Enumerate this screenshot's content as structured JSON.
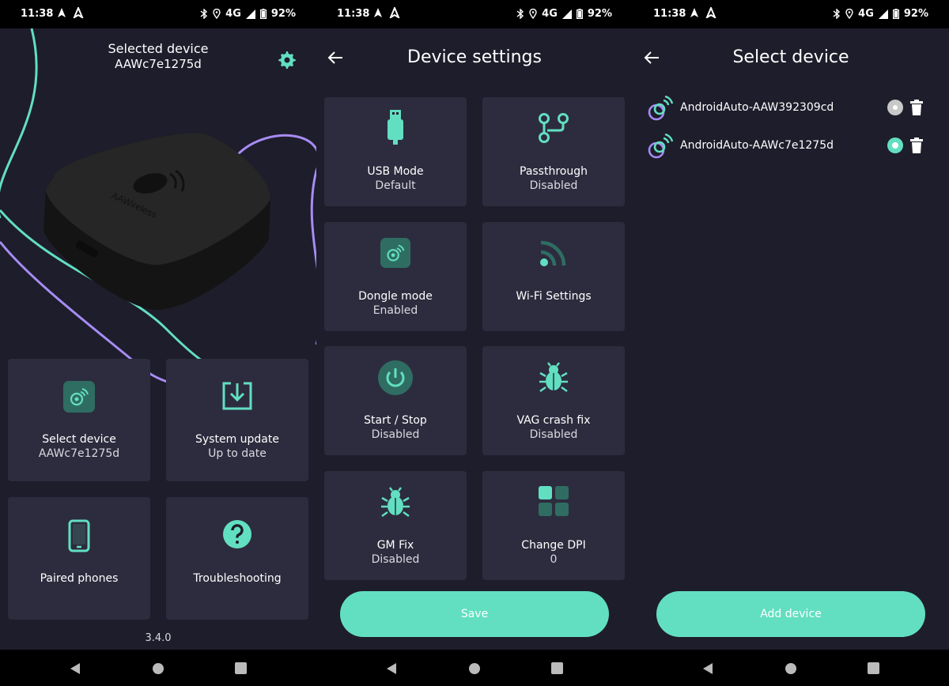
{
  "status_bar": {
    "time": "11:38",
    "network": "4G",
    "battery": "92%"
  },
  "home": {
    "selected_label": "Selected device",
    "selected_id": "AAWc7e1275d",
    "brand": "AAWireless",
    "tiles": [
      {
        "title": "Select device",
        "subtitle": "AAWc7e1275d"
      },
      {
        "title": "System update",
        "subtitle": "Up to date"
      },
      {
        "title": "Paired phones",
        "subtitle": ""
      },
      {
        "title": "Troubleshooting",
        "subtitle": ""
      }
    ],
    "version": "3.4.0"
  },
  "settings": {
    "title": "Device settings",
    "tiles": [
      {
        "title": "USB Mode",
        "subtitle": "Default",
        "icon": "usb-icon"
      },
      {
        "title": "Passthrough",
        "subtitle": "Disabled",
        "icon": "passthrough-icon"
      },
      {
        "title": "Dongle mode",
        "subtitle": "Enabled",
        "icon": "dongle-icon"
      },
      {
        "title": "Wi-Fi Settings",
        "subtitle": "",
        "icon": "wifi-icon"
      },
      {
        "title": "Start / Stop",
        "subtitle": "Disabled",
        "icon": "power-icon"
      },
      {
        "title": "VAG crash fix",
        "subtitle": "Disabled",
        "icon": "bug-icon"
      },
      {
        "title": "GM Fix",
        "subtitle": "Disabled",
        "icon": "bug-icon"
      },
      {
        "title": "Change DPI",
        "subtitle": "0",
        "icon": "grid-icon"
      }
    ],
    "save_label": "Save"
  },
  "select_device": {
    "title": "Select device",
    "devices": [
      {
        "name": "AndroidAuto-AAW392309cd",
        "selected": false
      },
      {
        "name": "AndroidAuto-AAWc7e1275d",
        "selected": true
      }
    ],
    "add_label": "Add device"
  },
  "colors": {
    "accent": "#62dfc1",
    "background": "#1e1d2b",
    "tile": "#2d2c3e",
    "secondary": "#a68cf4"
  }
}
